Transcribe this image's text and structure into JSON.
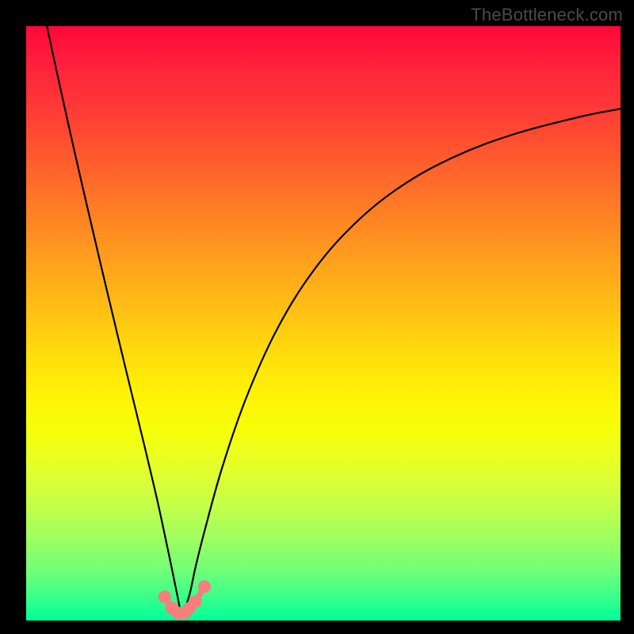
{
  "watermark": "TheBottleneck.com",
  "colors": {
    "frame": "#000000",
    "curve": "#000000",
    "marker": "#f87d7d",
    "gradient_top": "#ff073a",
    "gradient_bottom": "#00ff99"
  },
  "chart_data": {
    "type": "line",
    "title": "",
    "xlabel": "",
    "ylabel": "",
    "xlim": [
      0,
      100
    ],
    "ylim": [
      0,
      100
    ],
    "grid": false,
    "x_minimum": 26,
    "series": [
      {
        "name": "bottleneck-curve",
        "x": [
          3.5,
          5,
          8,
          11,
          14,
          17,
          20,
          22,
          23.3,
          24.5,
          25.5,
          26,
          26.6,
          27.5,
          28.5,
          30,
          33,
          37,
          42,
          48,
          55,
          63,
          72,
          82,
          93,
          100
        ],
        "y": [
          100,
          93,
          79.5,
          66.5,
          53.8,
          41.3,
          29,
          20.5,
          14.5,
          8.8,
          3.9,
          1.7,
          2.0,
          4.4,
          9.0,
          15.0,
          25.8,
          37.4,
          48.6,
          58.4,
          66.5,
          73.0,
          78.0,
          81.8,
          84.7,
          86.1
        ]
      }
    ],
    "markers": {
      "name": "highlight-points",
      "x": [
        23.3,
        24.5,
        25.5,
        26.6,
        27.5,
        28.5,
        30.0
      ],
      "y": [
        4.0,
        2.1,
        1.3,
        1.3,
        2.1,
        3.2,
        5.7
      ]
    }
  }
}
